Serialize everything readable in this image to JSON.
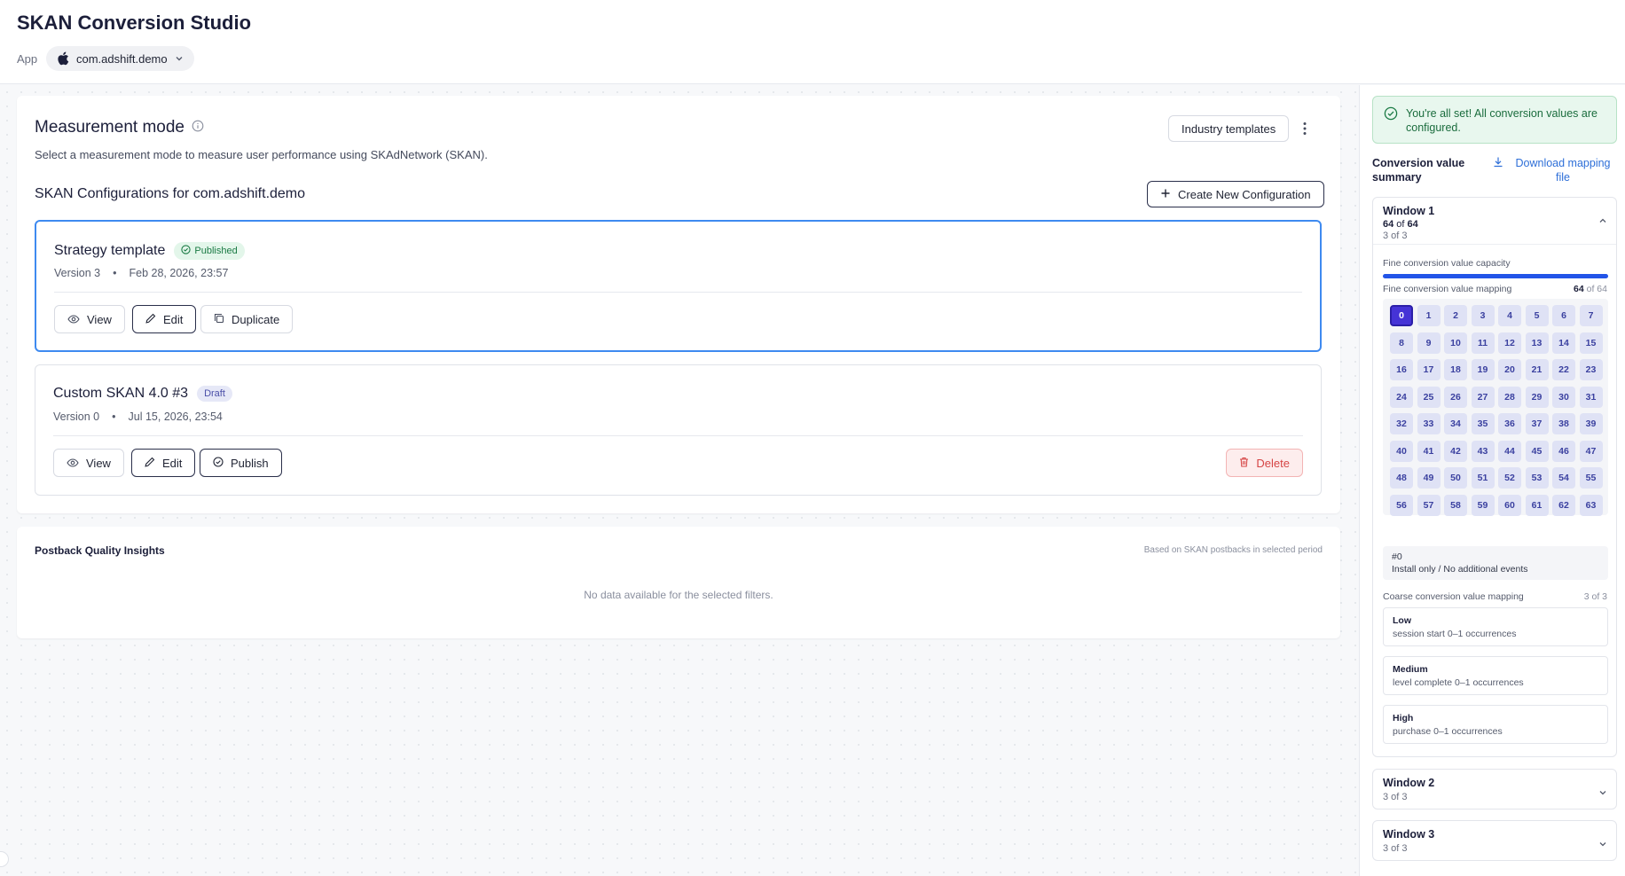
{
  "header": {
    "title": "SKAN Conversion Studio",
    "app_label": "App",
    "app_selected": "com.adshift.demo"
  },
  "main": {
    "mode_title": "Measurement mode",
    "mode_description": "Select a measurement mode to measure user performance using SKAdNetwork (SKAN).",
    "industry_templates_label": "Industry templates",
    "configs_title": "SKAN Configurations for com.adshift.demo",
    "create_label": "Create New Configuration",
    "configs": [
      {
        "name": "Strategy template",
        "status": "Published",
        "version": "Version 3",
        "date": "Feb 28, 2026, 23:57",
        "actions": [
          "View",
          "Edit",
          "Duplicate"
        ]
      },
      {
        "name": "Custom SKAN 4.0 #3",
        "status": "Draft",
        "version": "Version 0",
        "date": "Jul 15, 2026, 23:54",
        "actions": [
          "View",
          "Edit",
          "Publish"
        ],
        "delete_label": "Delete"
      }
    ],
    "bullet": "•"
  },
  "insights": {
    "title": "Postback Quality Insights",
    "note": "Based on SKAN postbacks in selected period",
    "empty": "No data available for the selected filters."
  },
  "panel": {
    "alert": "You're all set! All conversion values are configured.",
    "summary_title": "Conversion value summary",
    "download_label": "Download mapping file",
    "window1": {
      "title": "Window 1",
      "count_strong": "64",
      "count_of": " of ",
      "count_total": "64",
      "steps": "3 of 3",
      "capacity_label": "Fine conversion value capacity",
      "capacity_fill": 1.0,
      "mapping_label": "Fine conversion value mapping",
      "mapping_count_strong": "64",
      "mapping_count_rest": " of 64",
      "selected_value": 0,
      "info_id": "#0",
      "info_desc": "Install only / No additional events",
      "coarse_label": "Coarse conversion value mapping",
      "coarse_count": "3 of 3",
      "coarse": [
        {
          "title": "Low",
          "desc": "session start 0–1 occurrences"
        },
        {
          "title": "Medium",
          "desc": "level complete 0–1 occurrences"
        },
        {
          "title": "High",
          "desc": "purchase 0–1 occurrences"
        }
      ]
    },
    "window2": {
      "title": "Window 2",
      "steps": "3 of 3"
    },
    "window3": {
      "title": "Window 3",
      "steps": "3 of 3"
    }
  },
  "colors": {
    "accent": "#2254e8",
    "selected_cell": "#4533d6",
    "success": "#1a7a44",
    "danger": "#d64545",
    "link": "#2e6fd8"
  }
}
